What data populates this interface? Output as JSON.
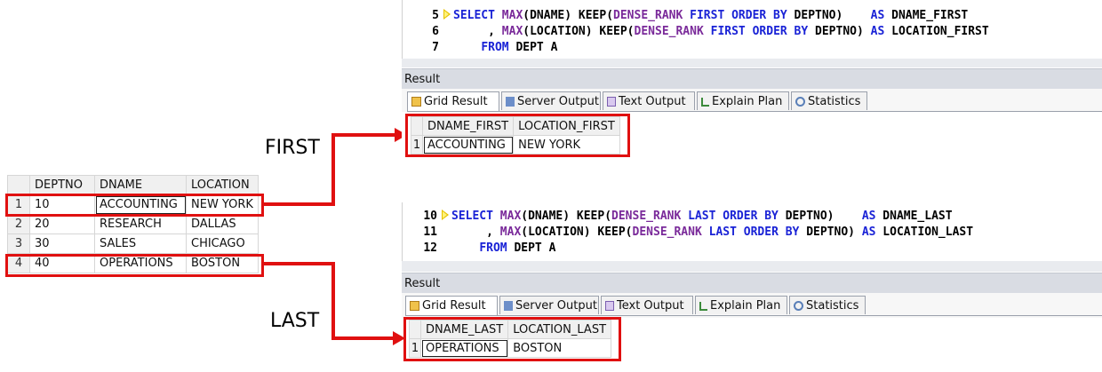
{
  "source_grid": {
    "columns": [
      "DEPTNO",
      "DNAME",
      "LOCATION"
    ],
    "rows": [
      {
        "n": "1",
        "deptno": "10",
        "dname": "ACCOUNTING",
        "location": "NEW YORK"
      },
      {
        "n": "2",
        "deptno": "20",
        "dname": "RESEARCH",
        "location": "DALLAS"
      },
      {
        "n": "3",
        "deptno": "30",
        "dname": "SALES",
        "location": "CHICAGO"
      },
      {
        "n": "4",
        "deptno": "40",
        "dname": "OPERATIONS",
        "location": "BOSTON"
      }
    ]
  },
  "labels": {
    "first": "FIRST",
    "last": "LAST"
  },
  "first_query": {
    "lines": [
      {
        "num": "5",
        "parts": [
          [
            "kw",
            "SELECT "
          ],
          [
            "fn",
            "MAX"
          ],
          [
            "",
            "(DNAME) KEEP("
          ],
          [
            "fn",
            "DENSE_RANK"
          ],
          [
            "kw",
            " FIRST ORDER BY"
          ],
          [
            "",
            " DEPTNO)    "
          ],
          [
            "kw",
            "AS"
          ],
          [
            "",
            " DNAME_FIRST"
          ]
        ]
      },
      {
        "num": "6",
        "parts": [
          [
            "",
            "     , "
          ],
          [
            "fn",
            "MAX"
          ],
          [
            "",
            "(LOCATION) KEEP("
          ],
          [
            "fn",
            "DENSE_RANK"
          ],
          [
            "kw",
            " FIRST ORDER BY"
          ],
          [
            "",
            " DEPTNO) "
          ],
          [
            "kw",
            "AS"
          ],
          [
            "",
            " LOCATION_FIRST"
          ]
        ]
      },
      {
        "num": "7",
        "parts": [
          [
            "",
            "    "
          ],
          [
            "kw",
            "FROM"
          ],
          [
            "",
            " DEPT A"
          ]
        ]
      }
    ],
    "result_title": "Result",
    "tabs": [
      "Grid Result",
      "Server Output",
      "Text Output",
      "Explain Plan",
      "Statistics"
    ],
    "columns": [
      "DNAME_FIRST",
      "LOCATION_FIRST"
    ],
    "row": {
      "n": "1",
      "a": "ACCOUNTING",
      "b": "NEW YORK"
    }
  },
  "last_query": {
    "lines": [
      {
        "num": "10",
        "parts": [
          [
            "kw",
            "SELECT "
          ],
          [
            "fn",
            "MAX"
          ],
          [
            "",
            "(DNAME) KEEP("
          ],
          [
            "fn",
            "DENSE_RANK"
          ],
          [
            "kw",
            " LAST ORDER BY"
          ],
          [
            "",
            " DEPTNO)    "
          ],
          [
            "kw",
            "AS"
          ],
          [
            "",
            " DNAME_LAST"
          ]
        ]
      },
      {
        "num": "11",
        "parts": [
          [
            "",
            "     , "
          ],
          [
            "fn",
            "MAX"
          ],
          [
            "",
            "(LOCATION) KEEP("
          ],
          [
            "fn",
            "DENSE_RANK"
          ],
          [
            "kw",
            " LAST ORDER BY"
          ],
          [
            "",
            " DEPTNO) "
          ],
          [
            "kw",
            "AS"
          ],
          [
            "",
            " LOCATION_LAST"
          ]
        ]
      },
      {
        "num": "12",
        "parts": [
          [
            "",
            "    "
          ],
          [
            "kw",
            "FROM"
          ],
          [
            "",
            " DEPT A"
          ]
        ]
      }
    ],
    "result_title": "Result",
    "tabs": [
      "Grid Result",
      "Server Output",
      "Text Output",
      "Explain Plan",
      "Statistics"
    ],
    "columns": [
      "DNAME_LAST",
      "LOCATION_LAST"
    ],
    "row": {
      "n": "1",
      "a": "OPERATIONS",
      "b": "BOSTON"
    }
  },
  "colors": {
    "highlight": "#e01010",
    "keyword": "#1a23d6",
    "function": "#7a2a9a"
  }
}
